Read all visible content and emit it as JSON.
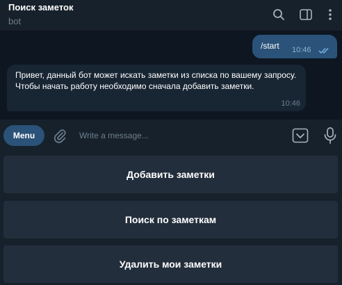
{
  "header": {
    "title": "Поиск заметок",
    "subtitle": "bot",
    "icons": [
      "search-icon",
      "sidebar-toggle-icon",
      "more-vertical-icon"
    ]
  },
  "messages": [
    {
      "direction": "outgoing",
      "text": "/start",
      "time": "10:46",
      "status": "read"
    },
    {
      "direction": "incoming",
      "text": "Привет, данный бот может искать заметки из списка по вашему запросу. Чтобы начать работу необходимо сначала добавить заметки.",
      "time": "10:46"
    }
  ],
  "composer": {
    "menu_label": "Menu",
    "placeholder": "Write a message...",
    "value": "",
    "icons": [
      "paperclip-icon",
      "keyboard-icon",
      "microphone-icon"
    ]
  },
  "reply_keyboard": [
    {
      "label": "Добавить заметки"
    },
    {
      "label": "Поиск по заметкам"
    },
    {
      "label": "Удалить мои заметки"
    }
  ],
  "colors": {
    "background": "#17212b",
    "chat_background": "#0e1621",
    "outgoing_bubble": "#2b5278",
    "incoming_bubble": "#182533",
    "keyboard_button": "#232e3c",
    "muted_text": "#6d7f8f",
    "read_checks": "#7db8ea"
  }
}
